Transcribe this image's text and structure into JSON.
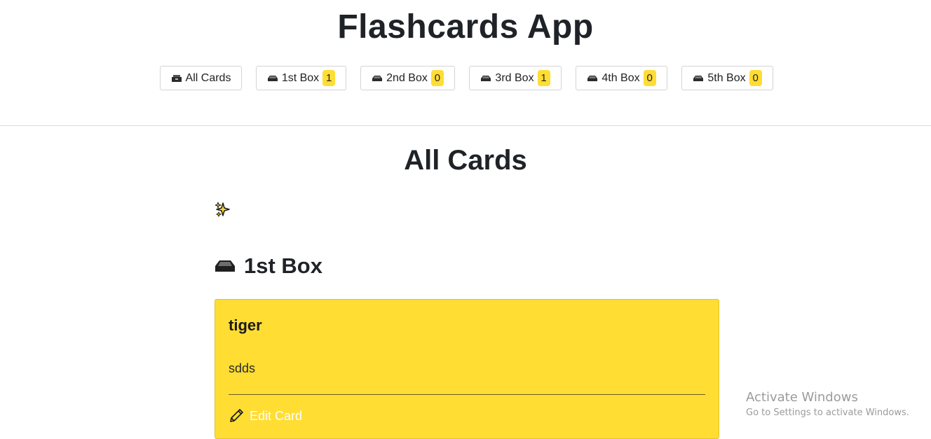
{
  "app": {
    "title": "Flashcards App"
  },
  "nav": {
    "items": [
      {
        "label": "All Cards",
        "icon": "card-file-box-icon",
        "count": null
      },
      {
        "label": "1st Box",
        "icon": "inbox-tray-icon",
        "count": "1"
      },
      {
        "label": "2nd Box",
        "icon": "inbox-tray-icon",
        "count": "0"
      },
      {
        "label": "3rd Box",
        "icon": "inbox-tray-icon",
        "count": "1"
      },
      {
        "label": "4th Box",
        "icon": "inbox-tray-icon",
        "count": "0"
      },
      {
        "label": "5th Box",
        "icon": "inbox-tray-icon",
        "count": "0"
      }
    ]
  },
  "main": {
    "title": "All Cards",
    "add_icon": "sparkles-icon",
    "boxes": [
      {
        "title": "1st Box",
        "icon": "inbox-tray-icon",
        "cards": [
          {
            "front": "tiger",
            "back": "sdds",
            "edit_label": "Edit Card"
          }
        ]
      }
    ]
  },
  "watermark": {
    "line1": "Activate Windows",
    "line2": "Go to Settings to activate Windows."
  },
  "colors": {
    "card_bg": "#ffdd33",
    "badge_bg": "#ffdd33",
    "divider": "#dcdcdc"
  }
}
